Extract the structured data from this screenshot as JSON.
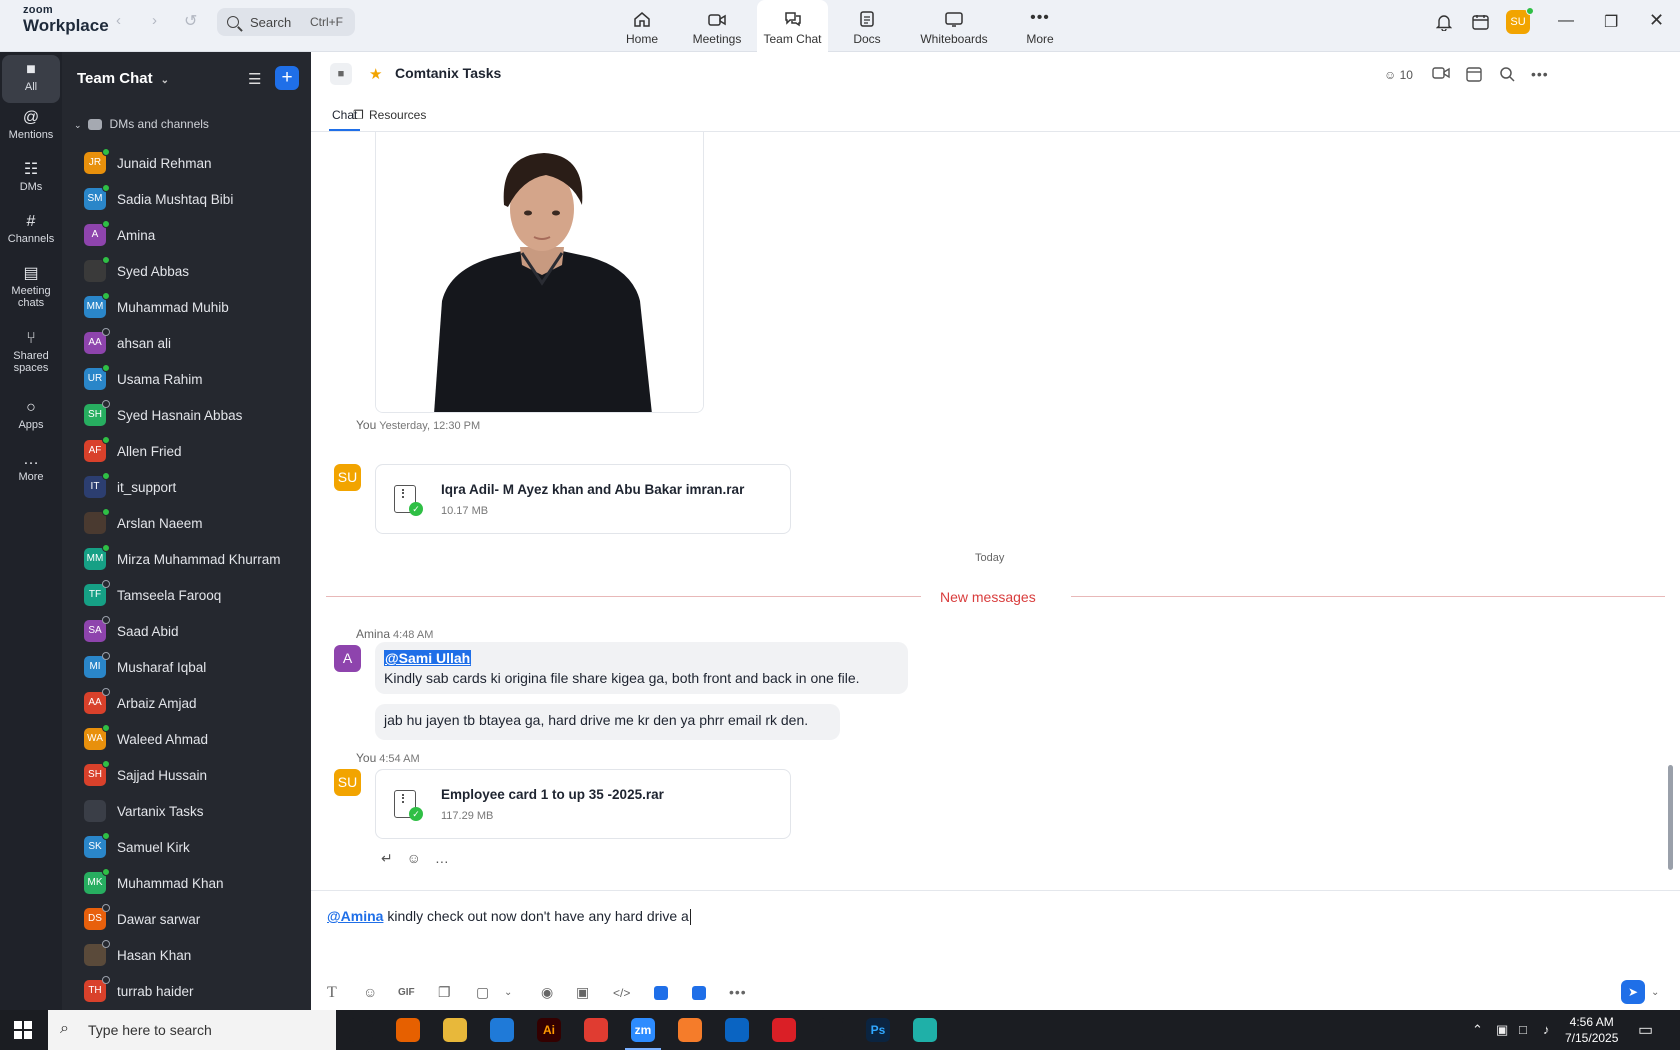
{
  "app": {
    "logo_line1": "zoom",
    "logo_line2": "Workplace",
    "search_placeholder": "Search",
    "search_shortcut": "Ctrl+F",
    "user_initials": "SU",
    "top_tabs": [
      {
        "label": "Home",
        "icon": "home-icon"
      },
      {
        "label": "Meetings",
        "icon": "video-icon"
      },
      {
        "label": "Team Chat",
        "icon": "chat-icon",
        "active": true
      },
      {
        "label": "Docs",
        "icon": "doc-icon"
      },
      {
        "label": "Whiteboards",
        "icon": "whiteboard-icon"
      },
      {
        "label": "More",
        "icon": "more-icon"
      }
    ]
  },
  "rail": [
    {
      "label": "All",
      "icon": "chat-bubble-icon",
      "active": true
    },
    {
      "label": "Mentions",
      "icon": "at-icon"
    },
    {
      "label": "DMs",
      "icon": "people-icon"
    },
    {
      "label": "Channels",
      "icon": "hash-icon"
    },
    {
      "label": "Meeting chats",
      "icon": "calendar-icon"
    },
    {
      "label": "Shared spaces",
      "icon": "share-icon"
    },
    {
      "label": "Apps",
      "icon": "apps-icon"
    },
    {
      "label": "More",
      "icon": "more-icon"
    }
  ],
  "sidebar": {
    "title": "Team Chat",
    "group_label": "DMs and channels",
    "items": [
      {
        "name": "Junaid Rehman",
        "initials": "JR",
        "color": "#e8900c",
        "status": "online"
      },
      {
        "name": "Sadia Mushtaq Bibi",
        "initials": "SM",
        "color": "#2a86c9",
        "status": "online"
      },
      {
        "name": "Amina",
        "initials": "A",
        "color": "#8e44ad",
        "status": "online"
      },
      {
        "name": "Syed Abbas",
        "initials": "",
        "color": "#3a3a3a",
        "status": "online"
      },
      {
        "name": "Muhammad Muhib",
        "initials": "MM",
        "color": "#2a86c9",
        "status": "online"
      },
      {
        "name": "ahsan ali",
        "initials": "AA",
        "color": "#8e44ad",
        "status": "offline"
      },
      {
        "name": "Usama Rahim",
        "initials": "UR",
        "color": "#2a86c9",
        "status": "online"
      },
      {
        "name": "Syed Hasnain Abbas",
        "initials": "SH",
        "color": "#27ae60",
        "status": "offline"
      },
      {
        "name": "Allen Fried",
        "initials": "AF",
        "color": "#d9412b",
        "status": "online"
      },
      {
        "name": "it_support",
        "initials": "IT",
        "color": "#2c3e70",
        "status": "online"
      },
      {
        "name": "Arslan Naeem",
        "initials": "",
        "color": "#4a3a30",
        "status": "online"
      },
      {
        "name": "Mirza Muhammad Khurram",
        "initials": "MM",
        "color": "#16a085",
        "status": "online"
      },
      {
        "name": "Tamseela Farooq",
        "initials": "TF",
        "color": "#16a085",
        "status": "offline"
      },
      {
        "name": "Saad Abid",
        "initials": "SA",
        "color": "#8e44ad",
        "status": "offline"
      },
      {
        "name": "Musharaf Iqbal",
        "initials": "MI",
        "color": "#2a86c9",
        "status": "offline"
      },
      {
        "name": "Arbaiz Amjad",
        "initials": "AA",
        "color": "#d9412b",
        "status": "offline"
      },
      {
        "name": "Waleed Ahmad",
        "initials": "WA",
        "color": "#e8900c",
        "status": "online"
      },
      {
        "name": "Sajjad Hussain",
        "initials": "SH",
        "color": "#d9412b",
        "status": "online"
      },
      {
        "name": "Vartanix Tasks",
        "initials": "",
        "color": "#3a3e47",
        "status": "none"
      },
      {
        "name": "Samuel Kirk",
        "initials": "SK",
        "color": "#2a86c9",
        "status": "online"
      },
      {
        "name": "Muhammad Khan",
        "initials": "MK",
        "color": "#27ae60",
        "status": "online"
      },
      {
        "name": "Dawar sarwar",
        "initials": "DS",
        "color": "#e8600c",
        "status": "offline"
      },
      {
        "name": "Hasan Khan",
        "initials": "",
        "color": "#5a4a3a",
        "status": "offline"
      },
      {
        "name": "turrab haider",
        "initials": "TH",
        "color": "#d9412b",
        "status": "offline"
      }
    ]
  },
  "chat": {
    "title": "Comtanix Tasks",
    "member_count": "10",
    "tabs": [
      "Chat",
      "Resources"
    ],
    "messages": {
      "file1": {
        "sender": "You",
        "time": "Yesterday, 12:30 PM",
        "avatar": "SU",
        "file_name": "Iqra Adil- M Ayez khan and Abu Bakar imran.rar",
        "file_size": "10.17 MB"
      },
      "today_label": "Today",
      "new_messages_label": "New messages",
      "amina": {
        "sender": "Amina",
        "time": "4:48 AM",
        "avatar": "A",
        "mention": "@Sami Ullah",
        "line1": "Kindly sab cards ki origina file share kigea ga, both front and back in one file.",
        "line2": "jab hu jayen tb btayea ga, hard drive me kr den ya phrr email rk den."
      },
      "file2": {
        "sender": "You",
        "time": "4:54 AM",
        "avatar": "SU",
        "file_name": "Employee card 1 to up 35 -2025.rar",
        "file_size": "117.29 MB"
      }
    }
  },
  "composer": {
    "mention": "@Amina",
    "text": " kindly check out now don't have any hard drive a",
    "tools": [
      "text-format-icon",
      "emoji-icon",
      "gif-icon",
      "file-icon",
      "screenshot-icon",
      "mic-icon",
      "video-clip-icon",
      "code-icon",
      "app-icon",
      "app-icon-2",
      "more-icon"
    ],
    "gif_label": "GIF"
  },
  "taskbar": {
    "search_placeholder": "Type here to search",
    "time": "4:56 AM",
    "date": "7/15/2025",
    "apps": [
      {
        "name": "task-view",
        "label": "",
        "color": "#1b1d22"
      },
      {
        "name": "firefox",
        "label": "",
        "color": "#e66000"
      },
      {
        "name": "file-explorer",
        "label": "",
        "color": "#e8b83a"
      },
      {
        "name": "vscode",
        "label": "",
        "color": "#1f7ad8"
      },
      {
        "name": "illustrator",
        "label": "Ai",
        "color": "#330000"
      },
      {
        "name": "chrome",
        "label": "",
        "color": "#e03c31"
      },
      {
        "name": "zoom",
        "label": "zm",
        "color": "#2d8cff",
        "active": true
      },
      {
        "name": "xampp",
        "label": "",
        "color": "#f57c2a"
      },
      {
        "name": "outlook",
        "label": "",
        "color": "#0a64c2"
      },
      {
        "name": "creative-cloud",
        "label": "",
        "color": "#da1f26"
      },
      {
        "name": "pen-tool",
        "label": "",
        "color": "#1b1d22"
      },
      {
        "name": "photoshop",
        "label": "Ps",
        "color": "#0b2440"
      },
      {
        "name": "other-app",
        "label": "",
        "color": "#1fb0a8"
      }
    ]
  }
}
